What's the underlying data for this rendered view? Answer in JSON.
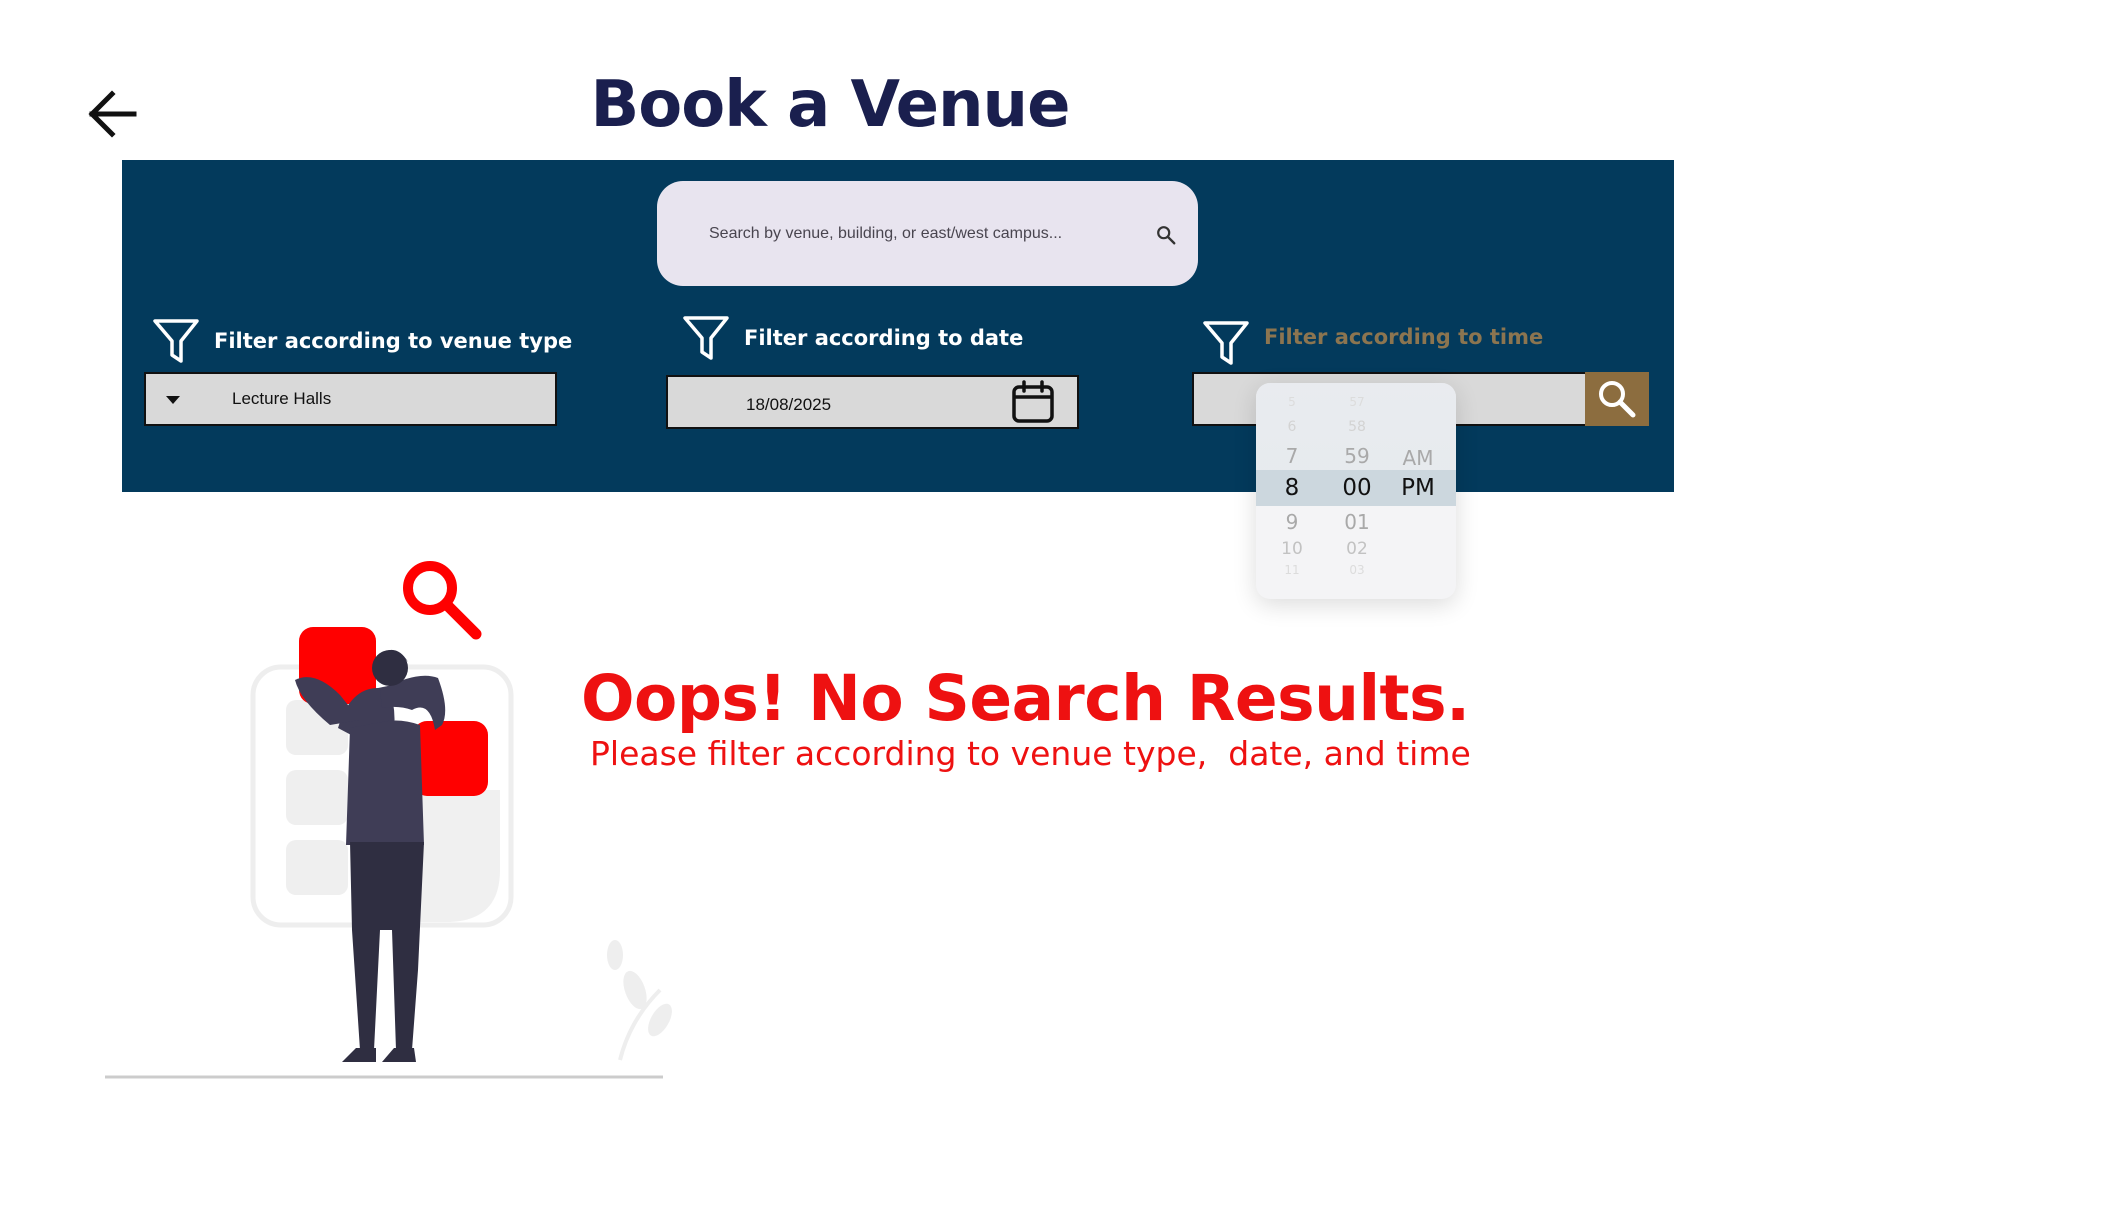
{
  "header": {
    "back_icon": "arrow-left-icon",
    "title": "Book a Venue"
  },
  "search": {
    "placeholder": "Search by venue, building, or east/west campus...",
    "icon": "search-icon"
  },
  "filters": {
    "venue_type": {
      "label": "Filter according to venue type",
      "value": "Lecture Halls",
      "icon": "filter-icon"
    },
    "date": {
      "label": "Filter according to date",
      "value": "18/08/2025",
      "icon": "filter-icon"
    },
    "time": {
      "label": "Filter according to time",
      "value": "",
      "icon": "filter-icon"
    }
  },
  "time_picker": {
    "hours": [
      "5",
      "6",
      "7",
      "8",
      "9",
      "10",
      "11"
    ],
    "minutes": [
      "57",
      "58",
      "59",
      "00",
      "01",
      "02",
      "03"
    ],
    "periods": [
      "AM",
      "PM"
    ],
    "selected": {
      "hour": "8",
      "minute": "00",
      "period": "PM"
    }
  },
  "colors": {
    "title": "#1a1f4e",
    "panel": "#033a5c",
    "accent": "#8c6d3f",
    "error": "#ee1111"
  },
  "empty_state": {
    "title": "Oops! No Search Results.",
    "message": "Please filter according to venue type,  date, and time",
    "illustration": "woman-searching-illustration"
  }
}
